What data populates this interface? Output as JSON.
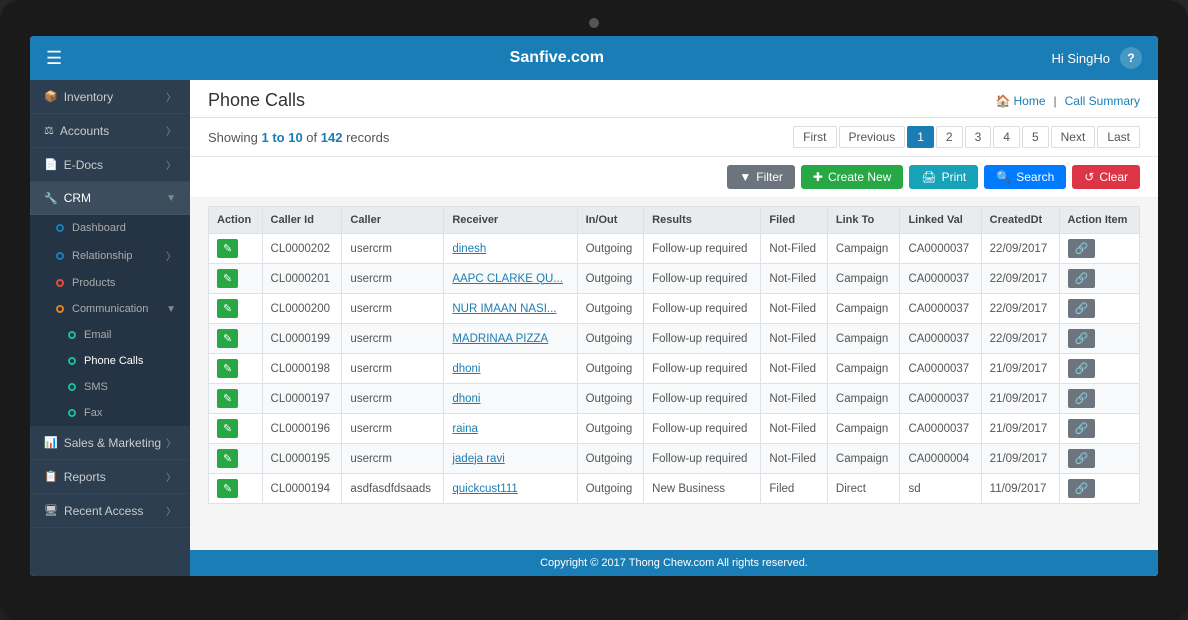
{
  "topbar": {
    "menu_icon": "☰",
    "title": "Sanfive.com",
    "greeting": "Hi SingHo",
    "help": "?"
  },
  "breadcrumb": {
    "home_label": "Home",
    "call_summary_label": "Call Summary"
  },
  "page": {
    "title": "Phone Calls",
    "records_text_prefix": "Showing ",
    "records_range": "1 to 10",
    "records_text_mid": " of ",
    "records_count": "142",
    "records_text_suffix": " records"
  },
  "pagination": {
    "first": "First",
    "prev": "Previous",
    "pages": [
      "1",
      "2",
      "3",
      "4",
      "5"
    ],
    "active_page": "1",
    "next": "Next",
    "last": "Last"
  },
  "toolbar": {
    "filter": "Filter",
    "create_new": "Create New",
    "print": "Print",
    "search": "Search",
    "clear": "Clear"
  },
  "table": {
    "columns": [
      "Action",
      "Caller Id",
      "Caller",
      "Receiver",
      "In/Out",
      "Results",
      "Filed",
      "Link To",
      "Linked Val",
      "CreatedDt",
      "Action Item"
    ],
    "rows": [
      {
        "caller_id": "CL0000202",
        "caller": "usercrm",
        "receiver": "dinesh",
        "inout": "Outgoing",
        "results": "Follow-up required",
        "filed": "Not-Filed",
        "link_to": "Campaign",
        "linked_val": "CA0000037",
        "created_dt": "22/09/2017"
      },
      {
        "caller_id": "CL0000201",
        "caller": "usercrm",
        "receiver": "AAPC CLARKE QU...",
        "inout": "Outgoing",
        "results": "Follow-up required",
        "filed": "Not-Filed",
        "link_to": "Campaign",
        "linked_val": "CA0000037",
        "created_dt": "22/09/2017"
      },
      {
        "caller_id": "CL0000200",
        "caller": "usercrm",
        "receiver": "NUR IMAAN NASI...",
        "inout": "Outgoing",
        "results": "Follow-up required",
        "filed": "Not-Filed",
        "link_to": "Campaign",
        "linked_val": "CA0000037",
        "created_dt": "22/09/2017"
      },
      {
        "caller_id": "CL0000199",
        "caller": "usercrm",
        "receiver": "MADRINAA PIZZA",
        "inout": "Outgoing",
        "results": "Follow-up required",
        "filed": "Not-Filed",
        "link_to": "Campaign",
        "linked_val": "CA0000037",
        "created_dt": "22/09/2017"
      },
      {
        "caller_id": "CL0000198",
        "caller": "usercrm",
        "receiver": "dhoni",
        "inout": "Outgoing",
        "results": "Follow-up required",
        "filed": "Not-Filed",
        "link_to": "Campaign",
        "linked_val": "CA0000037",
        "created_dt": "21/09/2017"
      },
      {
        "caller_id": "CL0000197",
        "caller": "usercrm",
        "receiver": "dhoni",
        "inout": "Outgoing",
        "results": "Follow-up required",
        "filed": "Not-Filed",
        "link_to": "Campaign",
        "linked_val": "CA0000037",
        "created_dt": "21/09/2017"
      },
      {
        "caller_id": "CL0000196",
        "caller": "usercrm",
        "receiver": "raina",
        "inout": "Outgoing",
        "results": "Follow-up required",
        "filed": "Not-Filed",
        "link_to": "Campaign",
        "linked_val": "CA0000037",
        "created_dt": "21/09/2017"
      },
      {
        "caller_id": "CL0000195",
        "caller": "usercrm",
        "receiver": "jadeja ravi",
        "inout": "Outgoing",
        "results": "Follow-up required",
        "filed": "Not-Filed",
        "link_to": "Campaign",
        "linked_val": "CA0000004",
        "created_dt": "21/09/2017"
      },
      {
        "caller_id": "CL0000194",
        "caller": "asdfasdfdsaads",
        "receiver": "quickcust111",
        "inout": "Outgoing",
        "results": "New Business",
        "filed": "Filed",
        "link_to": "Direct",
        "linked_val": "sd",
        "created_dt": "11/09/2017"
      }
    ]
  },
  "sidebar": {
    "items": [
      {
        "label": "Inventory",
        "icon": "📦",
        "has_sub": true
      },
      {
        "label": "Accounts",
        "icon": "⚖",
        "has_sub": true
      },
      {
        "label": "E-Docs",
        "icon": "📄",
        "has_sub": true
      },
      {
        "label": "CRM",
        "icon": "🔧",
        "has_sub": true,
        "active": true
      }
    ],
    "crm_sub": [
      {
        "label": "Dashboard",
        "icon": "grid",
        "dot_color": "blue"
      },
      {
        "label": "Relationship",
        "icon": "users",
        "dot_color": "blue",
        "has_sub": true
      },
      {
        "label": "Products",
        "icon": "circle",
        "dot_color": "blue"
      },
      {
        "label": "Communication",
        "icon": "envelope",
        "dot_color": "blue",
        "has_sub": true
      }
    ],
    "comm_sub": [
      {
        "label": "Email",
        "dot_color": "teal"
      },
      {
        "label": "Phone Calls",
        "dot_color": "teal",
        "active": true
      },
      {
        "label": "SMS",
        "dot_color": "teal"
      },
      {
        "label": "Fax",
        "dot_color": "teal"
      }
    ],
    "bottom_items": [
      {
        "label": "Sales & Marketing",
        "icon": "📊",
        "has_sub": true
      },
      {
        "label": "Reports",
        "icon": "📋",
        "has_sub": true
      },
      {
        "label": "Recent Access",
        "icon": "🖥",
        "has_sub": true
      }
    ]
  },
  "footer": {
    "text": "Copyright © 2017 Thong Chew.com All rights reserved."
  }
}
